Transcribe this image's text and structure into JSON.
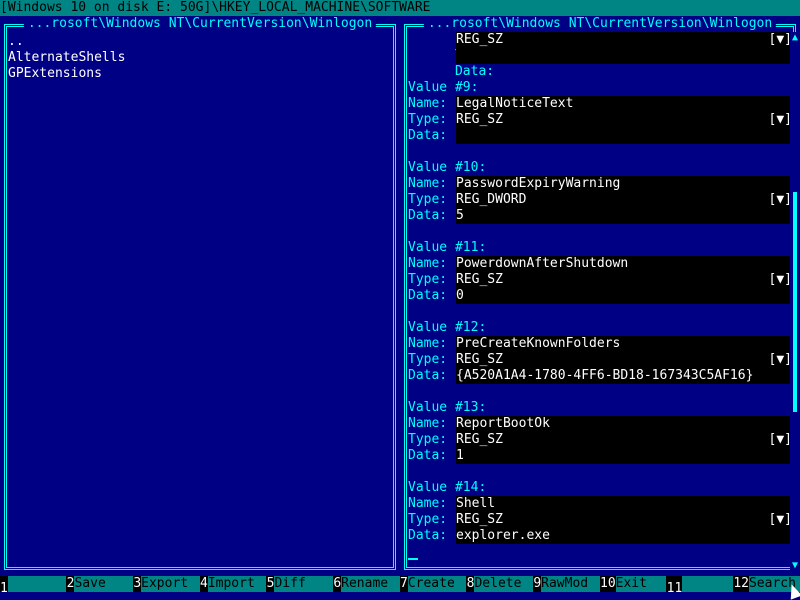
{
  "title_bar": "[Windows 10 on disk E: 50G]\\HKEY_LOCAL_MACHINE\\SOFTWARE",
  "left_panel": {
    "title": "...rosoft\\Windows NT\\CurrentVersion\\Winlogon",
    "items": [
      "..",
      "AlternateShells",
      "GPExtensions"
    ]
  },
  "right_panel": {
    "title": "...rosoft\\Windows NT\\CurrentVersion\\Winlogon",
    "labels": {
      "name": "Name:",
      "type": "Type:",
      "data": "Data:"
    },
    "dropdown_glyph": "[▼]",
    "partial_top": {
      "type": "REG_SZ",
      "data": ""
    },
    "values": [
      {
        "header": "Value #9:",
        "name": "LegalNoticeText",
        "type": "REG_SZ",
        "data": ""
      },
      {
        "header": "Value #10:",
        "name": "PasswordExpiryWarning",
        "type": "REG_DWORD",
        "data": "5"
      },
      {
        "header": "Value #11:",
        "name": "PowerdownAfterShutdown",
        "type": "REG_SZ",
        "data": "0"
      },
      {
        "header": "Value #12:",
        "name": "PreCreateKnownFolders",
        "type": "REG_SZ",
        "data": "{A520A1A4-1780-4FF6-BD18-167343C5AF16}"
      },
      {
        "header": "Value #13:",
        "name": "ReportBootOk",
        "type": "REG_SZ",
        "data": "1"
      },
      {
        "header": "Value #14:",
        "name": "Shell",
        "type": "REG_SZ",
        "data": "explorer.exe"
      }
    ]
  },
  "function_keys": [
    {
      "num": "1",
      "label": ""
    },
    {
      "num": "2",
      "label": "Save"
    },
    {
      "num": "3",
      "label": "Export"
    },
    {
      "num": "4",
      "label": "Import"
    },
    {
      "num": "5",
      "label": "Diff"
    },
    {
      "num": "6",
      "label": "Rename"
    },
    {
      "num": "7",
      "label": "Create"
    },
    {
      "num": "8",
      "label": "Delete"
    },
    {
      "num": "9",
      "label": "RawMod"
    },
    {
      "num": "10",
      "label": "Exit"
    },
    {
      "num": "11",
      "label": ""
    },
    {
      "num": "12",
      "label": "Search"
    }
  ],
  "colors": {
    "background": "#000084",
    "accent": "#00FFFF",
    "field": "#000000",
    "bar": "#008484"
  }
}
